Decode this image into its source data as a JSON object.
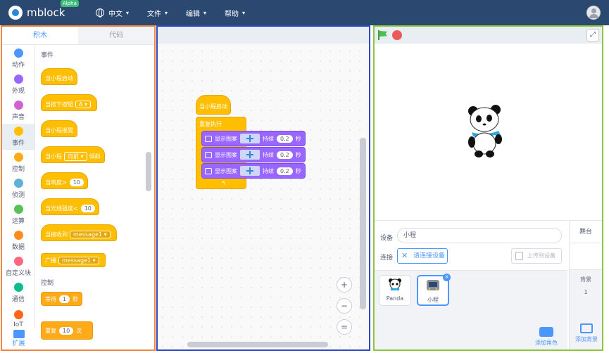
{
  "app": {
    "name": "mblock",
    "badge": "Alpha"
  },
  "menu": {
    "language": "中文",
    "file": "文件",
    "edit": "编辑",
    "help": "帮助"
  },
  "tabs": {
    "blocks": "积木",
    "code": "代码"
  },
  "categories": [
    {
      "label": "动作",
      "color": "#4c97ff"
    },
    {
      "label": "外观",
      "color": "#9966ff"
    },
    {
      "label": "声音",
      "color": "#cf63cf"
    },
    {
      "label": "事件",
      "color": "#ffbf00"
    },
    {
      "label": "控制",
      "color": "#ffab19"
    },
    {
      "label": "侦测",
      "color": "#5cb1d6"
    },
    {
      "label": "运算",
      "color": "#59c059"
    },
    {
      "label": "数据",
      "color": "#ff8c1a"
    },
    {
      "label": "自定义块",
      "color": "#ff6680"
    },
    {
      "label": "通信",
      "color": "#0fbd8c"
    },
    {
      "label": "IoT",
      "color": "#ff661a"
    }
  ],
  "extension_label": "扩展",
  "palette": {
    "events_heading": "事件",
    "control_heading": "控制",
    "when_program_starts": "当小程启动",
    "when_button_pressed": "当按下按钮",
    "button_option": "A",
    "when_shaken": "当小程摇晃",
    "when_prefix": "当小程",
    "tilt_option": "向前",
    "tilt_suffix": "倾斜",
    "loudness": "当响度>",
    "loudness_value": "10",
    "light": "当光线强度<",
    "light_value": "10",
    "when_receive": "当接收到",
    "message_option": "message1",
    "broadcast": "广播",
    "broadcast_option": "message1",
    "wait": "等待",
    "wait_value": "1",
    "wait_unit": "秒",
    "repeat": "重复",
    "repeat_value": "10",
    "repeat_unit": "次"
  },
  "script": {
    "hat": "当小程启动",
    "loop": "重复执行",
    "show_label": "显示图案",
    "duration_label": "持续",
    "duration_value": "0.2",
    "unit": "秒"
  },
  "zoom": {
    "in": "+",
    "out": "−",
    "reset": "="
  },
  "device": {
    "device_label": "设备",
    "device_value": "小程",
    "connect_label": "连接",
    "connect_button": "请连接设备",
    "upload_button": "上传到设备"
  },
  "sprites": [
    {
      "name": "Panda"
    },
    {
      "name": "小程"
    }
  ],
  "add_sprite": "添加角色",
  "stage_panel": {
    "title": "舞台",
    "background_label": "背景",
    "background_count": "1",
    "add_background": "添加背景"
  }
}
